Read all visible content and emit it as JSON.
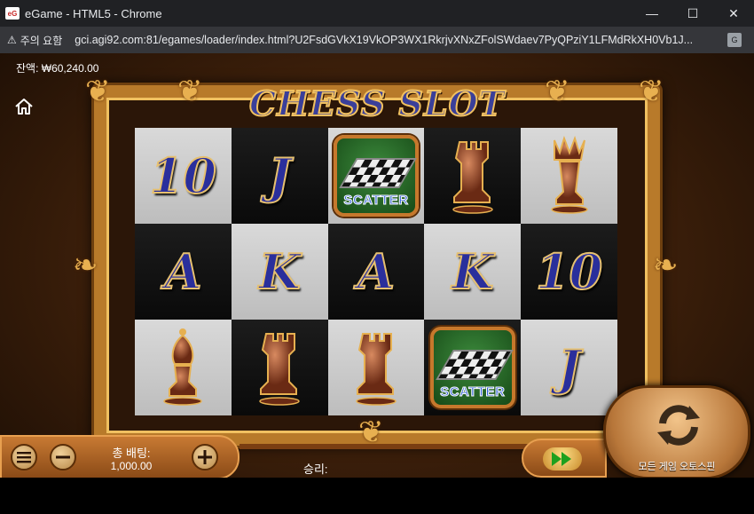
{
  "window": {
    "title": "eGame - HTML5 - Chrome",
    "app_icon_text": "eG",
    "minimize": "—",
    "maximize": "☐",
    "close": "✕"
  },
  "addressbar": {
    "warning_text": "주의 요함",
    "url": "gci.agi92.com:81/egames/loader/index.html?U2FsdGVkX19VkOP3WX1RkrjvXNxZFolSWdaev7PyQPziY1LFMdRkXH0Vb1J..."
  },
  "game": {
    "balance": "잔액: ₩60,240.00",
    "logo": "CHESS SLOT",
    "reels": [
      [
        {
          "type": "text",
          "value": "10"
        },
        {
          "type": "text",
          "value": "J"
        },
        {
          "type": "scatter",
          "value": "SCATTER"
        },
        {
          "type": "rook"
        },
        {
          "type": "queen"
        }
      ],
      [
        {
          "type": "text",
          "value": "A"
        },
        {
          "type": "text",
          "value": "K"
        },
        {
          "type": "text",
          "value": "A"
        },
        {
          "type": "text",
          "value": "K"
        },
        {
          "type": "text",
          "value": "10"
        }
      ],
      [
        {
          "type": "bishop"
        },
        {
          "type": "rook"
        },
        {
          "type": "rook"
        },
        {
          "type": "scatter",
          "value": "SCATTER"
        },
        {
          "type": "text",
          "value": "J"
        }
      ]
    ],
    "total_bet_label": "총 배팅:",
    "total_bet_value": "1,000.00",
    "win_label": "승리:",
    "autospin_label": "모든 게임 오토스핀"
  },
  "colors": {
    "frame_gold": "#b87a2a",
    "card_blue": "#2a2f9c",
    "piece_copper": "#9a3f22"
  }
}
